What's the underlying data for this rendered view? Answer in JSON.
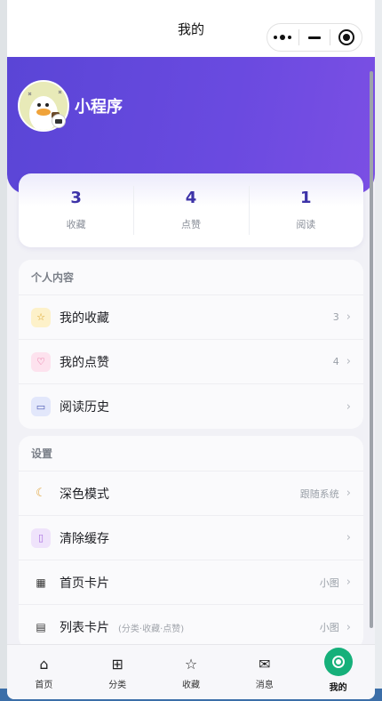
{
  "page": {
    "title": "我的"
  },
  "capsule": {
    "more_icon": "more-dots-icon",
    "minimize_icon": "minimize-icon",
    "close_icon": "target-circle-icon"
  },
  "profile": {
    "name": "小程序"
  },
  "stats": [
    {
      "value": "3",
      "label": "收藏"
    },
    {
      "value": "4",
      "label": "点赞"
    },
    {
      "value": "1",
      "label": "阅读"
    }
  ],
  "personal": {
    "title": "个人内容",
    "items": [
      {
        "label": "我的收藏",
        "right": "3",
        "icon": "star-icon"
      },
      {
        "label": "我的点赞",
        "right": "4",
        "icon": "heart-icon"
      },
      {
        "label": "阅读历史",
        "right": "",
        "icon": "book-icon"
      }
    ]
  },
  "settings": {
    "title": "设置",
    "items": [
      {
        "label": "深色模式",
        "right": "跟随系统",
        "icon": "moon-icon"
      },
      {
        "label": "清除缓存",
        "right": "",
        "icon": "trash-icon"
      },
      {
        "label": "首页卡片",
        "right": "小图",
        "icon": "grid-icon"
      },
      {
        "label": "列表卡片",
        "sub": "(分类·收藏·点赞)",
        "right": "小图",
        "icon": "list-icon"
      }
    ]
  },
  "tabbar": [
    {
      "label": "首页",
      "icon": "home-icon"
    },
    {
      "label": "分类",
      "icon": "category-grid-icon"
    },
    {
      "label": "收藏",
      "icon": "star-icon"
    },
    {
      "label": "消息",
      "icon": "mail-icon"
    },
    {
      "label": "我的",
      "icon": "profile-active-icon"
    }
  ],
  "colors": {
    "brand": "#6a4ae0",
    "stat_number": "#3d33a8",
    "active_tab": "#16b07a"
  }
}
